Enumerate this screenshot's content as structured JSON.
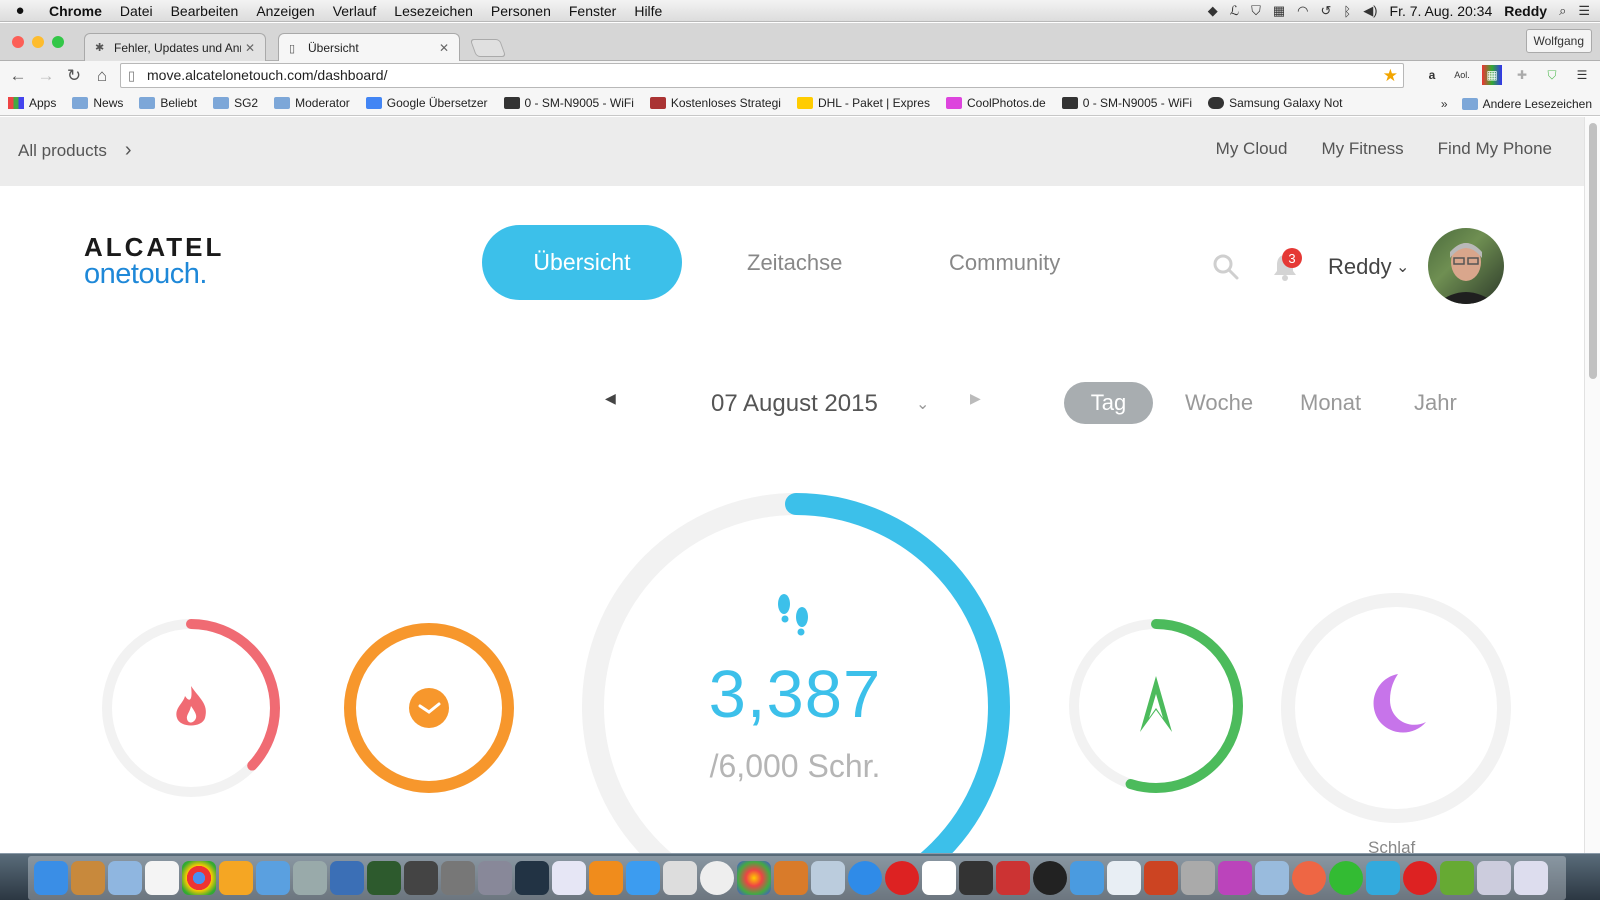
{
  "menubar": {
    "items": [
      "Chrome",
      "Datei",
      "Bearbeiten",
      "Anzeigen",
      "Verlauf",
      "Lesezeichen",
      "Personen",
      "Fenster",
      "Hilfe"
    ],
    "datetime": "Fr. 7. Aug.  20:34",
    "user": "Reddy"
  },
  "browser": {
    "tabs": [
      {
        "title": "Fehler, Updates und Anreg"
      },
      {
        "title": "Übersicht"
      }
    ],
    "profile": "Wolfgang",
    "url": "move.alcatelonetouch.com/dashboard/",
    "bookmarks": [
      "Apps",
      "News",
      "Beliebt",
      "SG2",
      "Moderator",
      "Google Übersetzer",
      "0 - SM-N9005 - WiFi",
      "Kostenloses Strategi",
      "DHL - Paket | Expres",
      "CoolPhotos.de",
      "0 - SM-N9005 - WiFi",
      "Samsung Galaxy Not"
    ],
    "bookmarks_overflow": "»",
    "other_bookmarks": "Andere Lesezeichen"
  },
  "site": {
    "all_products": "All products",
    "links": [
      "My Cloud",
      "My Fitness",
      "Find My Phone"
    ],
    "logo_line1": "ALCATEL",
    "logo_line2": "onetouch.",
    "nav": {
      "active": "Übersicht",
      "timeline": "Zeitachse",
      "community": "Community"
    },
    "notifications": "3",
    "user": "Reddy"
  },
  "date": {
    "label": "07 August 2015",
    "periods": {
      "day": "Tag",
      "week": "Woche",
      "month": "Monat",
      "year": "Jahr"
    }
  },
  "metrics": {
    "steps": {
      "value": "3,387",
      "goal": "/6,000 Schr.",
      "progress": 0.5645,
      "color": "#3cc0ea"
    },
    "calories": {
      "progress": 0.37,
      "color": "#f06b73",
      "icon": "flame-icon"
    },
    "active_time": {
      "progress": 1.0,
      "color": "#f7972c",
      "icon": "clock-icon"
    },
    "distance": {
      "progress": 0.55,
      "color": "#4cbb5c",
      "icon": "compass-icon"
    },
    "sleep": {
      "progress": 0.0,
      "color": "#c774ea",
      "icon": "moon-icon",
      "label": "Schlaf"
    }
  }
}
